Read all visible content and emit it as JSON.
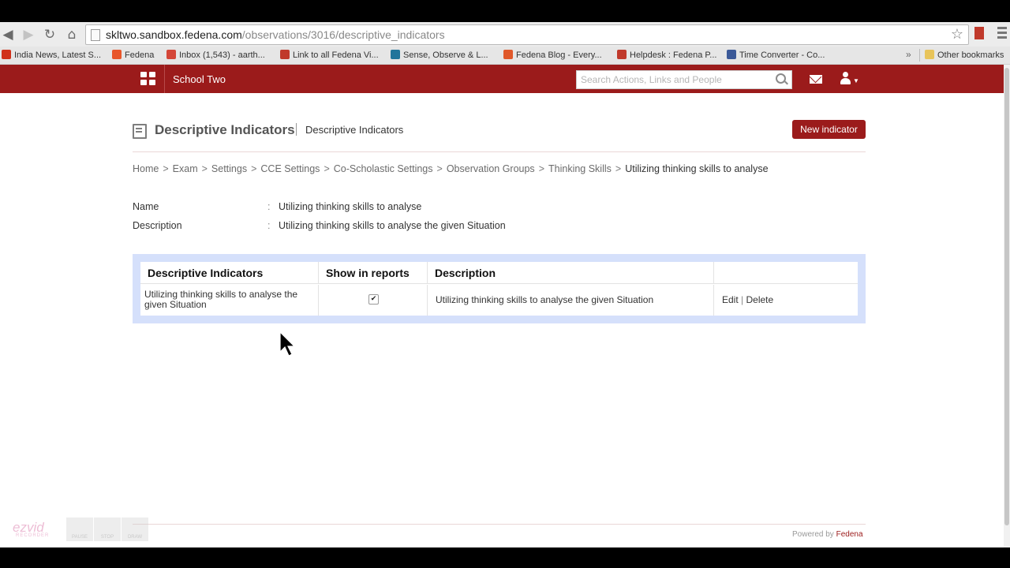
{
  "browser": {
    "url_host": "skltwo.sandbox.fedena.com",
    "url_path": "/observations/3016/descriptive_indicators",
    "bookmarks": [
      {
        "label": "India News, Latest S...",
        "color": "#d0311a"
      },
      {
        "label": "Fedena",
        "color": "#e8562a"
      },
      {
        "label": "Inbox (1,543) - aarth...",
        "color": "#d44638"
      },
      {
        "label": "Link to all Fedena Vi...",
        "color": "#c0392b"
      },
      {
        "label": "Sense, Observe & L...",
        "color": "#21759b"
      },
      {
        "label": "Fedena Blog - Every...",
        "color": "#e0582a"
      },
      {
        "label": "Helpdesk : Fedena P...",
        "color": "#c0392b"
      },
      {
        "label": "Time Converter - Co...",
        "color": "#3b5998"
      }
    ],
    "other_bookmarks": "Other bookmarks"
  },
  "app": {
    "school_name": "School Two",
    "search_placeholder": "Search Actions, Links and People",
    "brand_color": "#9b1b1b"
  },
  "header": {
    "title": "Descriptive Indicators",
    "subtitle": "Descriptive Indicators",
    "new_button": "New indicator"
  },
  "breadcrumb": {
    "items": [
      "Home",
      "Exam",
      "Settings",
      "CCE Settings",
      "Co-Scholastic Settings",
      "Observation Groups",
      "Thinking Skills"
    ],
    "current": "Utilizing thinking skills to analyse",
    "separator": ">"
  },
  "details": {
    "name_label": "Name",
    "name_value": "Utilizing thinking skills to analyse",
    "description_label": "Description",
    "description_value": "Utilizing thinking skills to analyse the given Situation",
    "colon": ":"
  },
  "table": {
    "headers": [
      "Descriptive Indicators",
      "Show in reports",
      "Description",
      ""
    ],
    "rows": [
      {
        "indicator": "Utilizing thinking skills to analyse the given Situation",
        "show_in_reports": true,
        "check_glyph": "✔",
        "description": "Utilizing thinking skills to analyse the given Situation",
        "edit": "Edit",
        "action_sep": "|",
        "delete": "Delete"
      }
    ]
  },
  "footer": {
    "powered_by": "Powered by",
    "brand": "Fedena"
  },
  "overlay": {
    "recorder_logo": "ezvid",
    "recorder_sub": "RECORDER",
    "pause": "PAUSE",
    "stop": "STOP",
    "draw": "DRAW"
  }
}
